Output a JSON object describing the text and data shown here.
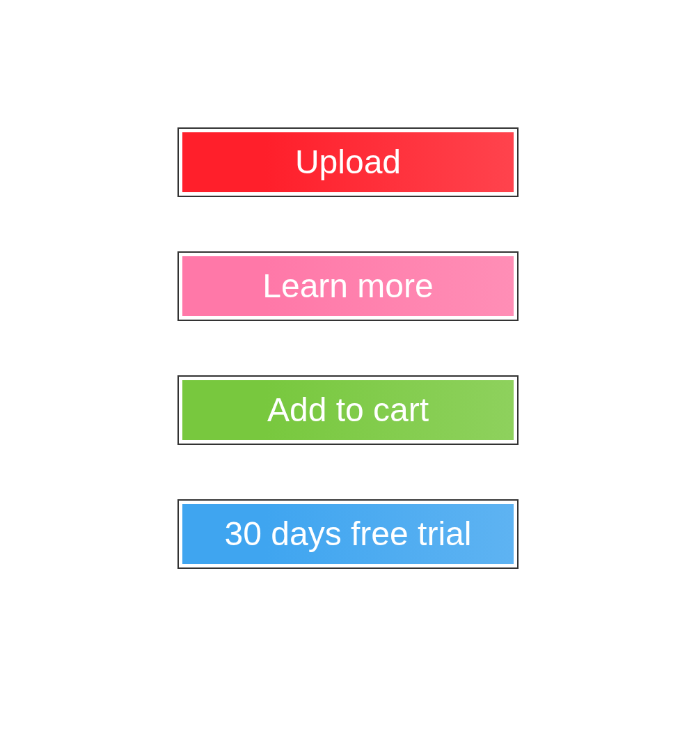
{
  "buttons": [
    {
      "label": "Upload",
      "color": "#ff1f2b"
    },
    {
      "label": "Learn more",
      "color": "#ff78a8"
    },
    {
      "label": "Add to cart",
      "color": "#78c83e"
    },
    {
      "label": "30 days free trial",
      "color": "#3fa5f0"
    }
  ]
}
